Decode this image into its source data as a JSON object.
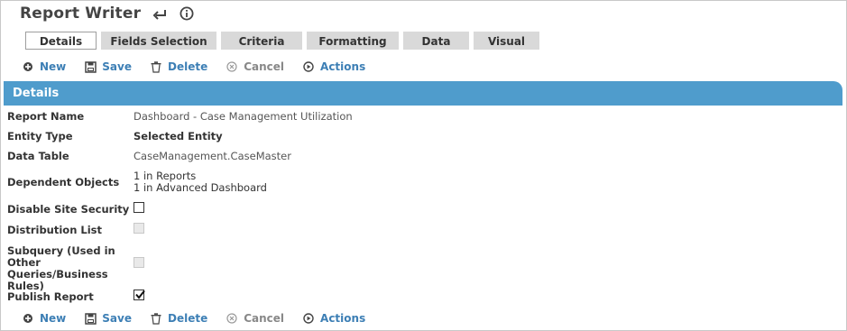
{
  "app": {
    "title": "Report Writer",
    "accent": "#4f9ccc",
    "link_color": "#3d7fb5"
  },
  "tabs": [
    {
      "label": "Details",
      "active": true
    },
    {
      "label": "Fields Selection",
      "active": false
    },
    {
      "label": "Criteria",
      "active": false
    },
    {
      "label": "Formatting",
      "active": false
    },
    {
      "label": "Data",
      "active": false
    },
    {
      "label": "Visual",
      "active": false
    }
  ],
  "toolbar": {
    "new": "New",
    "save": "Save",
    "delete": "Delete",
    "cancel": "Cancel",
    "actions": "Actions"
  },
  "section": {
    "title": "Details"
  },
  "fields": {
    "report_name": {
      "label": "Report Name",
      "value": "Dashboard - Case Management Utilization"
    },
    "entity_type": {
      "label": "Entity Type",
      "value": "Selected Entity"
    },
    "data_table": {
      "label": "Data Table",
      "value": "CaseManagement.CaseMaster"
    },
    "dependent_objects": {
      "label": "Dependent Objects",
      "value_line1": "1 in Reports",
      "value_line2": "1 in Advanced Dashboard"
    },
    "disable_site_security": {
      "label": "Disable Site Security",
      "checked": false
    },
    "distribution_list": {
      "label": "Distribution List",
      "checked": false,
      "disabled": true
    },
    "subquery": {
      "label_line1": "Subquery (Used in",
      "label_line2": "Other Queries/Business",
      "label_line3": "Rules)",
      "checked": false,
      "disabled": true
    },
    "publish_report": {
      "label": "Publish Report",
      "checked": true
    }
  }
}
